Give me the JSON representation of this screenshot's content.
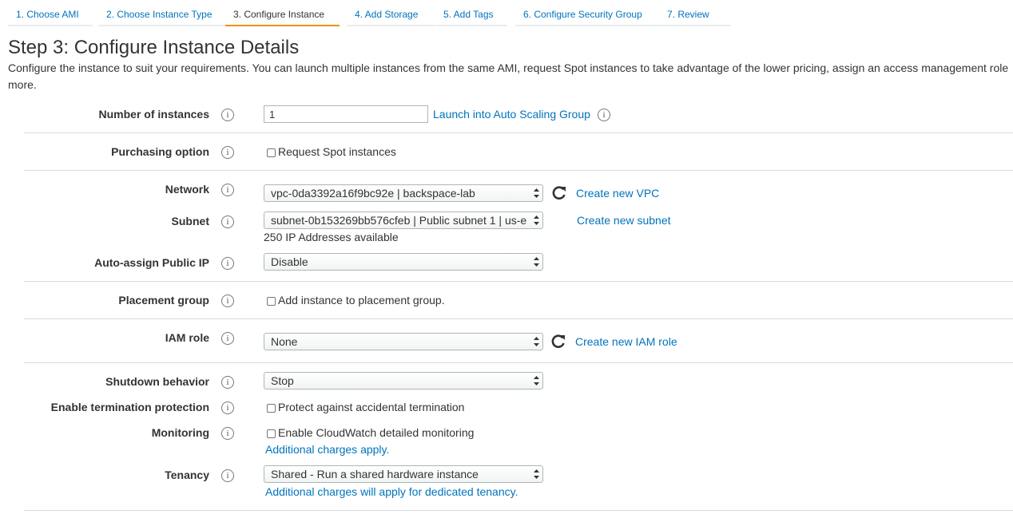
{
  "tabs": [
    {
      "label": "1. Choose AMI",
      "active": false
    },
    {
      "label": "2. Choose Instance Type",
      "active": false
    },
    {
      "label": "3. Configure Instance",
      "active": true
    },
    {
      "label": "4. Add Storage",
      "active": false
    },
    {
      "label": "5. Add Tags",
      "active": false
    },
    {
      "label": "6. Configure Security Group",
      "active": false
    },
    {
      "label": "7. Review",
      "active": false
    }
  ],
  "header": {
    "title": "Step 3: Configure Instance Details",
    "description_line1": "Configure the instance to suit your requirements. You can launch multiple instances from the same AMI, request Spot instances to take advantage of the lower pricing, assign an access management role",
    "description_line2": "more."
  },
  "fields": {
    "number_of_instances": {
      "label": "Number of instances",
      "value": "1",
      "link": "Launch into Auto Scaling Group"
    },
    "purchasing_option": {
      "label": "Purchasing option",
      "checkbox_label": "Request Spot instances",
      "checked": false
    },
    "network": {
      "label": "Network",
      "value": "vpc-0da3392a16f9bc92e | backspace-lab",
      "link": "Create new VPC"
    },
    "subnet": {
      "label": "Subnet",
      "value": "subnet-0b153269bb576cfeb | Public subnet 1 | us-e",
      "link": "Create new subnet",
      "note": "250 IP Addresses available"
    },
    "auto_assign_public_ip": {
      "label": "Auto-assign Public IP",
      "value": "Disable"
    },
    "placement_group": {
      "label": "Placement group",
      "checkbox_label": "Add instance to placement group.",
      "checked": false
    },
    "iam_role": {
      "label": "IAM role",
      "value": "None",
      "link": "Create new IAM role"
    },
    "shutdown_behavior": {
      "label": "Shutdown behavior",
      "value": "Stop"
    },
    "termination_protection": {
      "label": "Enable termination protection",
      "checkbox_label": "Protect against accidental termination",
      "checked": false
    },
    "monitoring": {
      "label": "Monitoring",
      "checkbox_label": "Enable CloudWatch detailed monitoring",
      "checked": false,
      "note_link": "Additional charges apply."
    },
    "tenancy": {
      "label": "Tenancy",
      "value": "Shared - Run a shared hardware instance",
      "note_link": "Additional charges will apply for dedicated tenancy."
    }
  },
  "icons": {
    "info": "info-icon",
    "refresh": "refresh-icon",
    "select_arrows": "select-arrows-icon"
  },
  "info_glyph": "i",
  "colors": {
    "link": "#0073bb",
    "active_tab_underline": "#ec9214",
    "separator": "#d5dbdb"
  }
}
